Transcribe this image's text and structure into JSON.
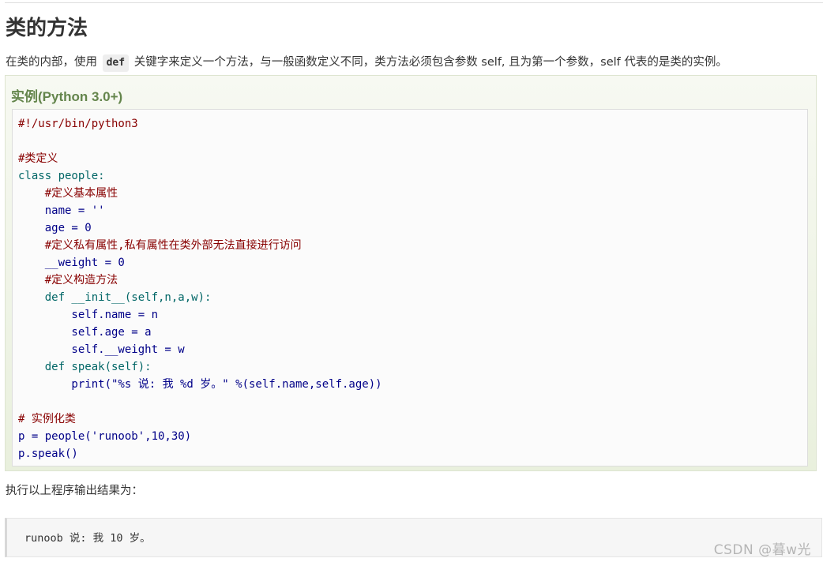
{
  "section": {
    "title": "类的方法",
    "intro_before": "在类的内部，使用 ",
    "intro_code": "def",
    "intro_after": " 关键字来定义一个方法，与一般函数定义不同，类方法必须包含参数 self, 且为第一个参数，self 代表的是类的实例。"
  },
  "example": {
    "title": "实例(Python 3.0+)",
    "code_lines": [
      "#!/usr/bin/python3",
      "",
      "#类定义",
      "class people:",
      "    #定义基本属性",
      "    name = ''",
      "    age = 0",
      "    #定义私有属性,私有属性在类外部无法直接进行访问",
      "    __weight = 0",
      "    #定义构造方法",
      "    def __init__(self,n,a,w):",
      "        self.name = n",
      "        self.age = a",
      "        self.__weight = w",
      "    def speak(self):",
      "        print(\"%s 说: 我 %d 岁。\" %(self.name,self.age))",
      "",
      "# 实例化类",
      "p = people('runoob',10,30)",
      "p.speak()"
    ]
  },
  "output": {
    "label": "执行以上程序输出结果为：",
    "text": "runoob 说: 我 10 岁。"
  },
  "watermark": "CSDN @暮w光"
}
